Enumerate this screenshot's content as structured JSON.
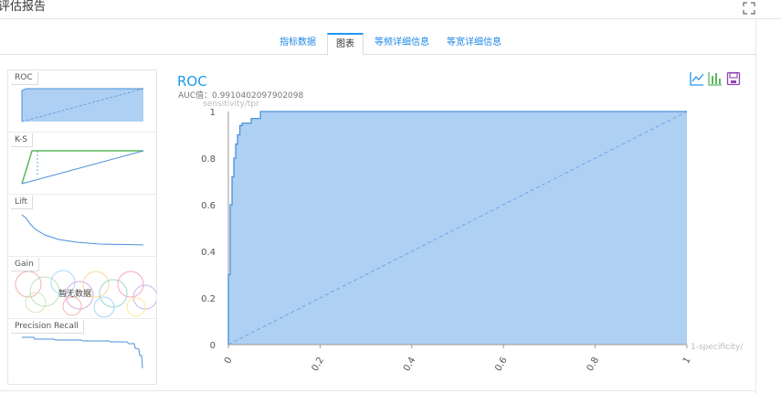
{
  "header": {
    "title": "评估报告"
  },
  "tabs": [
    {
      "label": "指标数据",
      "active": false
    },
    {
      "label": "图表",
      "active": true
    },
    {
      "label": "等频详细信息",
      "active": false
    },
    {
      "label": "等宽详细信息",
      "active": false
    }
  ],
  "thumbnails": [
    {
      "label": "ROC"
    },
    {
      "label": "K-S"
    },
    {
      "label": "Lift"
    },
    {
      "label": "Gain",
      "empty_text": "暂无数据"
    },
    {
      "label": "Precision Recall"
    }
  ],
  "main_chart": {
    "title": "ROC",
    "auc_text": "AUC值：0.9910402097902098"
  },
  "toolbox": [
    "line-chart-icon",
    "bar-chart-icon",
    "save-icon"
  ],
  "colors": {
    "accent": "#2196f3",
    "area": "#aed0f3",
    "line": "#4a90d9",
    "ks_green": "#5cb85c",
    "toolbox_purple": "#8e44ad"
  },
  "chart_data": {
    "type": "area",
    "title": "ROC",
    "xlabel": "1-specificity/",
    "ylabel": "sensitivity/tpr",
    "xlim": [
      0,
      1
    ],
    "ylim": [
      0,
      1
    ],
    "x_ticks": [
      "0",
      "0.2",
      "0.4",
      "0.6",
      "0.8",
      "1"
    ],
    "y_ticks": [
      "0",
      "0.2",
      "0.4",
      "0.6",
      "0.8",
      "1"
    ],
    "grid": false,
    "series": [
      {
        "x": [
          0,
          0,
          0.004,
          0.004,
          0.008,
          0.008,
          0.012,
          0.012,
          0.016,
          0.016,
          0.02,
          0.02,
          0.025,
          0.025,
          0.03,
          0.03,
          0.05,
          0.05,
          0.07,
          0.07,
          1
        ],
        "y": [
          0,
          0.3,
          0.3,
          0.6,
          0.6,
          0.72,
          0.72,
          0.8,
          0.8,
          0.86,
          0.86,
          0.9,
          0.9,
          0.94,
          0.94,
          0.95,
          0.95,
          0.97,
          0.97,
          1,
          1
        ]
      },
      {
        "x": [
          0,
          1
        ],
        "y": [
          0,
          1
        ]
      }
    ]
  }
}
